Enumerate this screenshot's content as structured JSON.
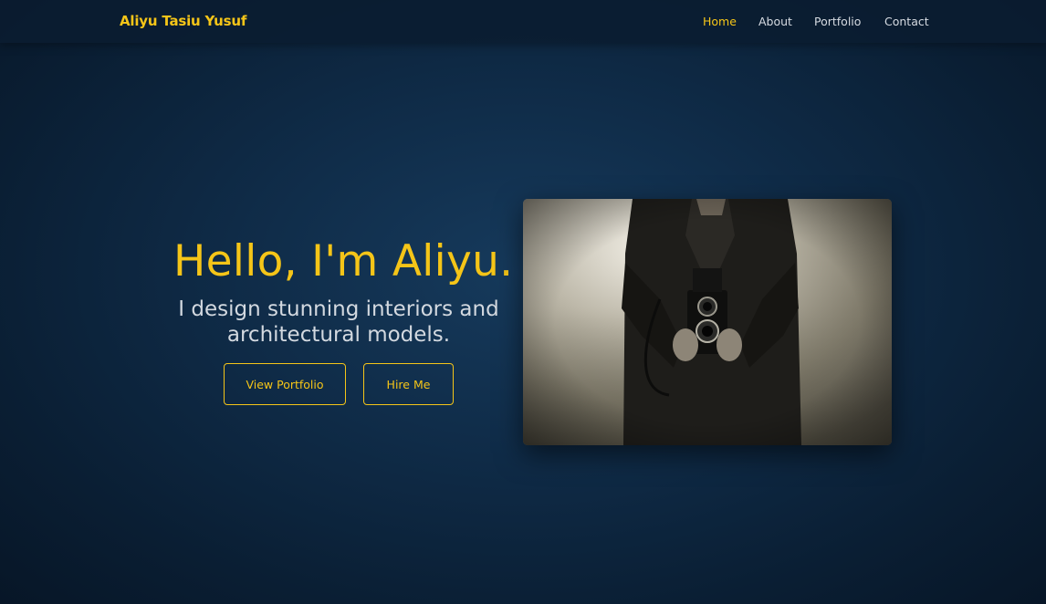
{
  "navbar": {
    "brand": "Aliyu Tasiu Yusuf",
    "links": [
      {
        "label": "Home",
        "active": true
      },
      {
        "label": "About",
        "active": false
      },
      {
        "label": "Portfolio",
        "active": false
      },
      {
        "label": "Contact",
        "active": false
      }
    ]
  },
  "hero": {
    "title": "Hello, I'm Aliyu.",
    "subtitle": "I design stunning interiors and architectural models.",
    "buttons": {
      "portfolio": "View Portfolio",
      "hire": "Hire Me"
    },
    "photo_alt": "Man holding a twin-lens reflex camera"
  },
  "colors": {
    "accent": "#f5c518",
    "background": "#0f2b47",
    "nav_text": "#d6dbe2"
  }
}
